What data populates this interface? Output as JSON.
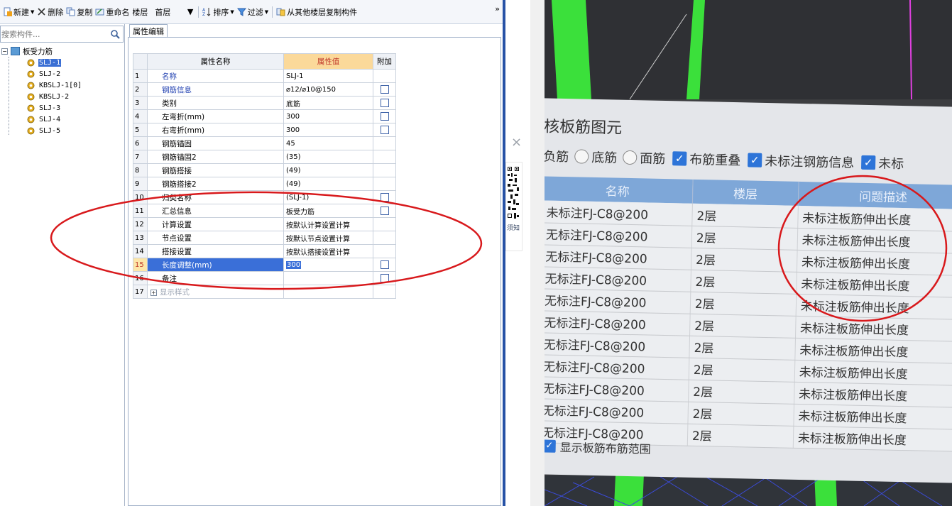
{
  "toolbar": {
    "new_label": "新建",
    "delete_label": "删除",
    "copy_label": "复制",
    "rename_label": "重命名",
    "floor_label": "楼层",
    "floor_value": "首层",
    "sort_label": "排序",
    "filter_label": "过滤",
    "copy_from_floor_label": "从其他楼层复制构件",
    "more_label": "»"
  },
  "left_pane": {
    "search_placeholder": "搜索构件...",
    "tree_root": "板受力筋",
    "tree_items": [
      "SLJ-1",
      "SLJ-2",
      "KBSLJ-1[0]",
      "KBSLJ-2",
      "SLJ-3",
      "SLJ-4",
      "SLJ-5"
    ],
    "selected_index": 0
  },
  "property_editor": {
    "tab_label": "属性编辑",
    "headers": {
      "name": "属性名称",
      "value": "属性值",
      "extra": "附加"
    },
    "rows": [
      {
        "no": "1",
        "name": "名称",
        "value": "SLJ-1",
        "checkbox": false
      },
      {
        "no": "2",
        "name": "钢筋信息",
        "value": "⌀12/⌀10@150",
        "checkbox": true
      },
      {
        "no": "3",
        "name": "类别",
        "value": "底筋",
        "checkbox": true
      },
      {
        "no": "4",
        "name": "左弯折(mm)",
        "value": "300",
        "checkbox": true
      },
      {
        "no": "5",
        "name": "右弯折(mm)",
        "value": "300",
        "checkbox": true
      },
      {
        "no": "6",
        "name": "钢筋锚固",
        "value": "45",
        "checkbox": false
      },
      {
        "no": "7",
        "name": "钢筋锚固2",
        "value": "(35)",
        "checkbox": false
      },
      {
        "no": "8",
        "name": "钢筋搭接",
        "value": "(49)",
        "checkbox": false
      },
      {
        "no": "9",
        "name": "钢筋搭接2",
        "value": "(49)",
        "checkbox": false
      },
      {
        "no": "10",
        "name": "归类名称",
        "value": "(SLJ-1)",
        "checkbox": true
      },
      {
        "no": "11",
        "name": "汇总信息",
        "value": "板受力筋",
        "checkbox": true
      },
      {
        "no": "12",
        "name": "计算设置",
        "value": "按默认计算设置计算",
        "checkbox": false
      },
      {
        "no": "13",
        "name": "节点设置",
        "value": "按默认节点设置计算",
        "checkbox": false
      },
      {
        "no": "14",
        "name": "搭接设置",
        "value": "按默认搭接设置计算",
        "checkbox": false
      },
      {
        "no": "15",
        "name": "长度调整(mm)",
        "value": "300",
        "checkbox": true
      },
      {
        "no": "16",
        "name": "备注",
        "value": "",
        "checkbox": true
      },
      {
        "no": "17",
        "name": "显示样式",
        "value": "",
        "checkbox": false
      }
    ],
    "highlight_row": 15
  },
  "side_widget": {
    "close_label": "×",
    "qr_label": "须知"
  },
  "photo_dialog": {
    "title": "核板筋图元",
    "filters": [
      "负筋",
      "底筋",
      "面筋",
      "布筋重叠",
      "未标注钢筋信息",
      "未标"
    ],
    "headers": [
      "名称",
      "楼层",
      "问题描述"
    ],
    "rows": [
      [
        "未标注FJ-C8@200",
        "2层",
        "未标注板筋伸出长度"
      ],
      [
        "无标注FJ-C8@200",
        "2层",
        "未标注板筋伸出长度"
      ],
      [
        "无标注FJ-C8@200",
        "2层",
        "未标注板筋伸出长度"
      ],
      [
        "无标注FJ-C8@200",
        "2层",
        "未标注板筋伸出长度"
      ],
      [
        "无标注FJ-C8@200",
        "2层",
        "未标注板筋伸出长度"
      ],
      [
        "无标注FJ-C8@200",
        "2层",
        "未标注板筋伸出长度"
      ],
      [
        "无标注FJ-C8@200",
        "2层",
        "未标注板筋伸出长度"
      ],
      [
        "无标注FJ-C8@200",
        "2层",
        "未标注板筋伸出长度"
      ],
      [
        "无标注FJ-C8@200",
        "2层",
        "未标注板筋伸出长度"
      ],
      [
        "无标注FJ-C8@200",
        "2层",
        "未标注板筋伸出长度"
      ],
      [
        "无标注FJ-C8@200",
        "2层",
        "未标注板筋伸出长度"
      ]
    ],
    "bottom_checkbox_label": "显示板筋布筋范围"
  },
  "colors": {
    "selection": "#3a6fd8",
    "annotation": "#d8191c",
    "header_value": "#fbd99a",
    "green_beam": "#3be03b"
  }
}
